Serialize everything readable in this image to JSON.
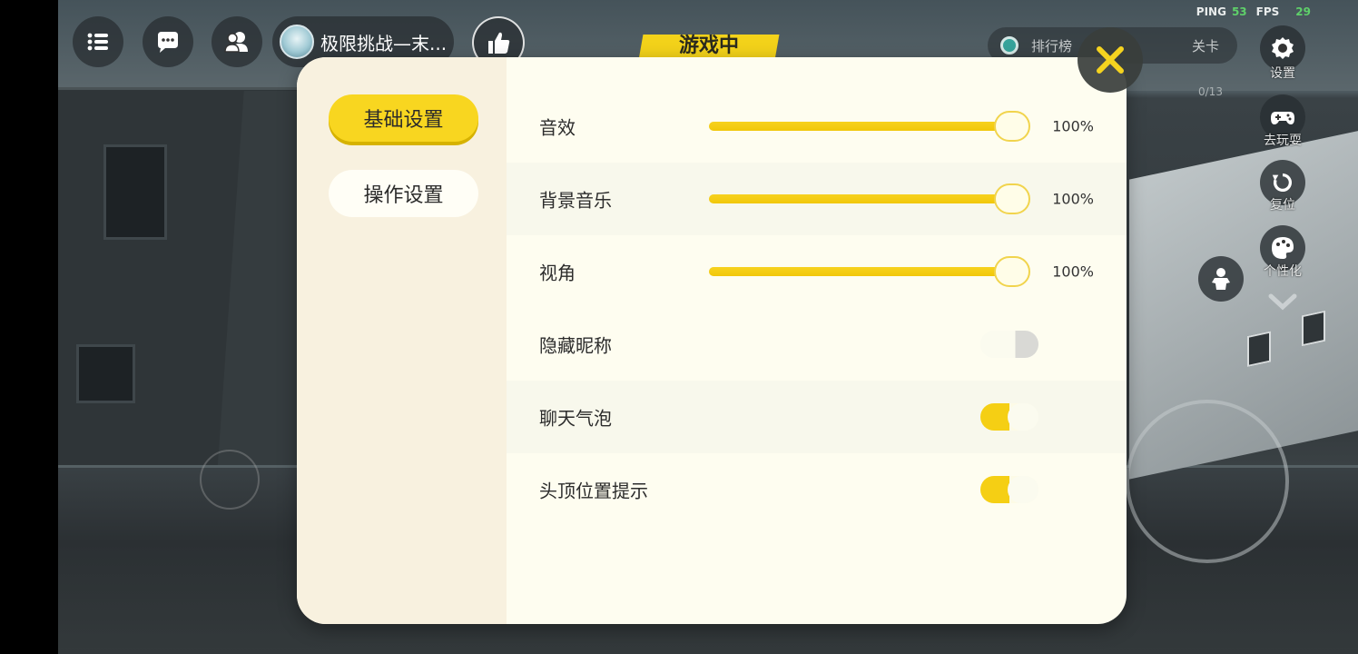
{
  "hud": {
    "room_name": "极限挑战—末...",
    "status": "游戏中",
    "ping_label": "PING",
    "ping_value": "53",
    "fps_label": "FPS",
    "fps_value": "29",
    "rank_label": "排行榜",
    "level_label": "关卡",
    "progress": "0/13"
  },
  "side_menu": {
    "settings": "设置",
    "play": "去玩耍",
    "reset": "复位",
    "customize": "个性化"
  },
  "settings": {
    "tabs": [
      "基础设置",
      "操作设置"
    ],
    "active_tab": "基础设置",
    "sliders": [
      {
        "label": "音效",
        "value": 100,
        "display": "100%"
      },
      {
        "label": "背景音乐",
        "value": 100,
        "display": "100%"
      },
      {
        "label": "视角",
        "value": 100,
        "display": "100%"
      }
    ],
    "toggles": [
      {
        "label": "隐藏昵称",
        "on": false
      },
      {
        "label": "聊天气泡",
        "on": true
      },
      {
        "label": "头顶位置提示",
        "on": true
      }
    ]
  },
  "colors": {
    "accent": "#f8d620",
    "panel_bg": "#fefdf0",
    "sidebar_bg": "#f8f1df"
  },
  "icons": {
    "menu": "list-icon",
    "chat": "chat-bubble-icon",
    "friends": "friends-icon",
    "like": "thumbs-up-icon",
    "close": "close-icon",
    "settings": "gear-icon",
    "play": "gamepad-icon",
    "reset": "reset-icon",
    "customize": "palette-icon",
    "emote": "character-icon"
  }
}
